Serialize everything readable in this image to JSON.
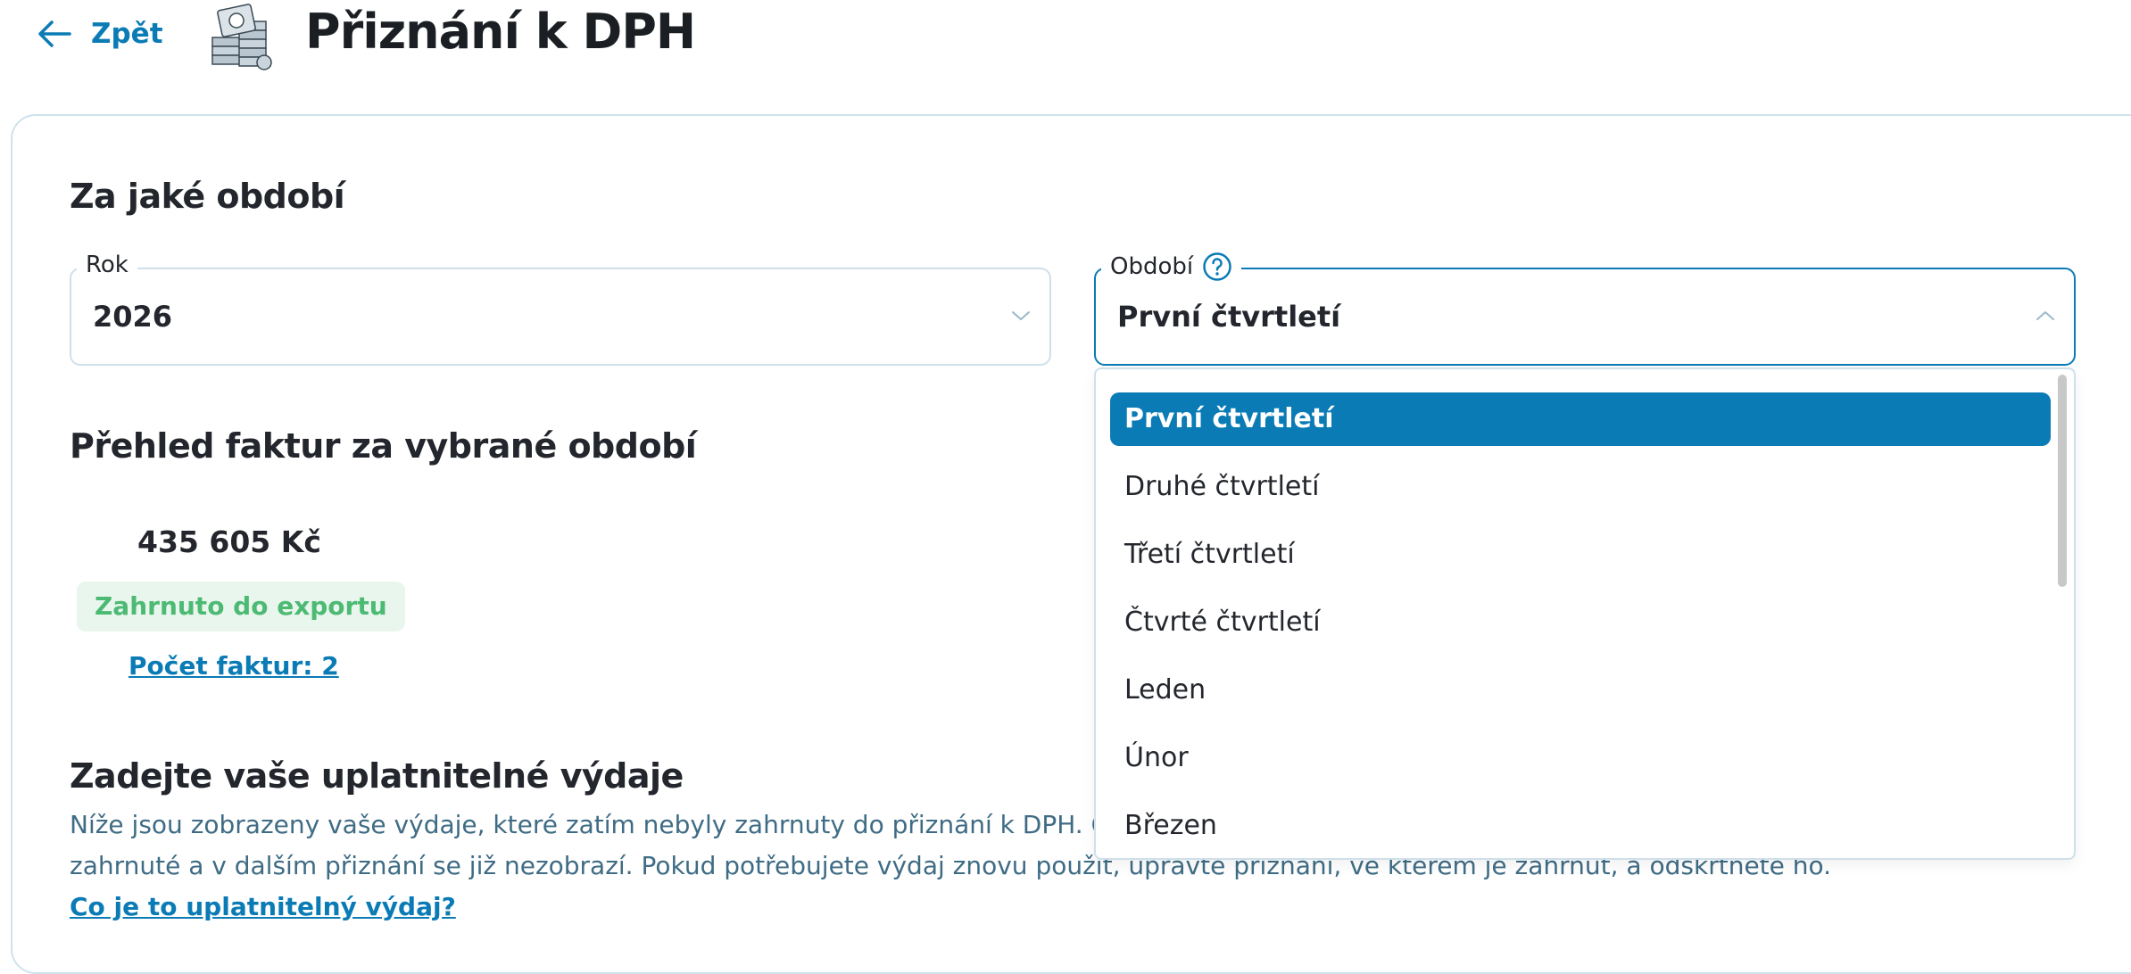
{
  "header": {
    "back_label": "Zpět",
    "title": "Přiznání k DPH",
    "icon": "money-stack-icon"
  },
  "period_section": {
    "title": "Za jaké období",
    "year_field": {
      "label": "Rok",
      "value": "2026"
    },
    "period_field": {
      "label": "Období",
      "value": "První čtvrtletí",
      "options": [
        "První čtvrtletí",
        "Druhé čtvrtletí",
        "Třetí čtvrtletí",
        "Čtvrté čtvrtletí",
        "Leden",
        "Únor",
        "Březen"
      ],
      "selected_index": 0
    }
  },
  "invoices_section": {
    "title": "Přehled faktur za vybrané období",
    "amount": "435 605 Kč",
    "status_badge": "Zahrnuto do exportu",
    "count_link": "Počet faktur: 2"
  },
  "expenses_section": {
    "title": "Zadejte vaše uplatnitelné výdaje",
    "description_line1": "Níže jsou zobrazeny vaše výdaje, které zatím nebyly zahrnuty do přiznání k DPH. Odšk",
    "description_line2": "zahrnuté a v dalším přiznání se již nezobrazí. Pokud potřebujete výdaj znovu použít, upravte přiznání, ve kterém je zahrnut, a odskrtnete ho.",
    "help_link": "Co je to uplatnitelný výdaj?"
  },
  "colors": {
    "accent": "#0a7bb5",
    "success_text": "#4dba73",
    "success_bg": "#e9f6ee",
    "border": "#cfe0ea"
  }
}
